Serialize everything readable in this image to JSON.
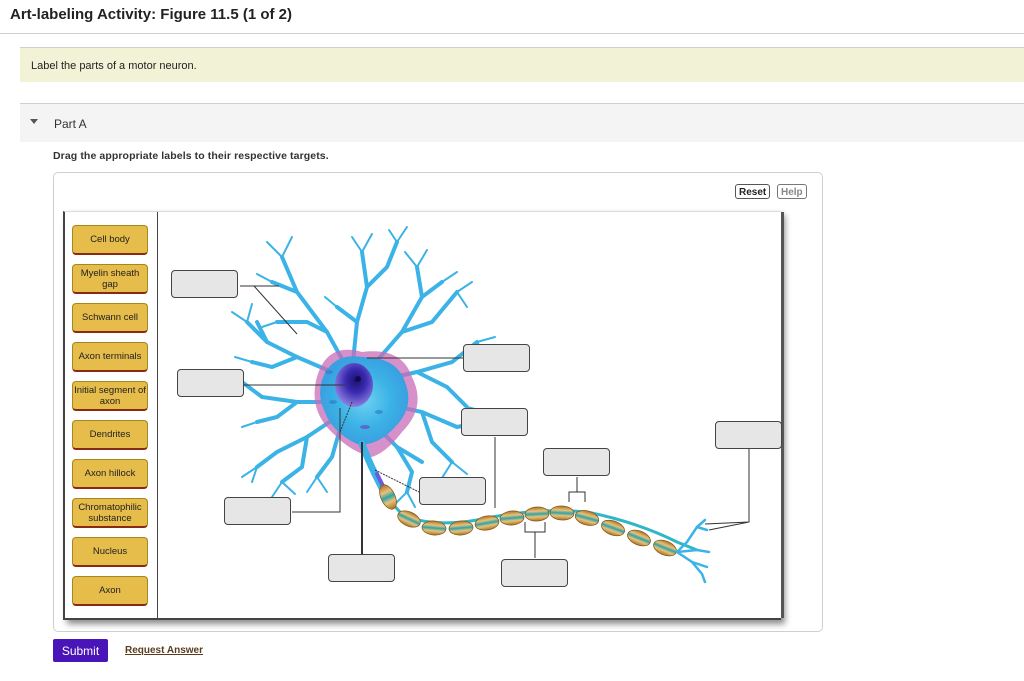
{
  "header": {
    "title": "Art-labeling Activity: Figure 11.5 (1 of 2)"
  },
  "intro": {
    "text": "Label the parts of a motor neuron."
  },
  "part": {
    "title": "Part A",
    "expanded": true,
    "instructions": "Drag the appropriate labels to their respective targets."
  },
  "toolbar": {
    "reset_label": "Reset",
    "help_label": "Help"
  },
  "labels": [
    {
      "text": "Cell body"
    },
    {
      "text": "Myelin sheath gap"
    },
    {
      "text": "Schwann cell"
    },
    {
      "text": "Axon terminals"
    },
    {
      "text": "Initial segment of axon"
    },
    {
      "text": "Dendrites"
    },
    {
      "text": "Axon hillock"
    },
    {
      "text": "Chromatophilic substance"
    },
    {
      "text": "Nucleus"
    },
    {
      "text": "Axon"
    }
  ],
  "targets": [
    {
      "id": "target-1",
      "value": ""
    },
    {
      "id": "target-2",
      "value": ""
    },
    {
      "id": "target-3",
      "value": ""
    },
    {
      "id": "target-4",
      "value": ""
    },
    {
      "id": "target-5",
      "value": ""
    },
    {
      "id": "target-6",
      "value": ""
    },
    {
      "id": "target-7",
      "value": ""
    },
    {
      "id": "target-8",
      "value": ""
    },
    {
      "id": "target-9",
      "value": ""
    },
    {
      "id": "target-10",
      "value": ""
    }
  ],
  "colors": {
    "label_fill": "#e6bc4a",
    "submit": "#4a15b8",
    "intro_bg": "#f1f2d6",
    "dendrite": "#3bb3e6",
    "soma_pink": "#c86bb8",
    "nucleus": "#3a2ab0",
    "myelin": "#d9a94a",
    "myelin_core": "#2fa3a8"
  },
  "footer": {
    "submit_label": "Submit",
    "request_answer_label": "Request Answer"
  }
}
